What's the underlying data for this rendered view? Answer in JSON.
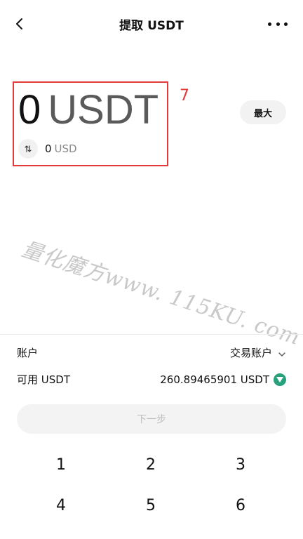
{
  "header": {
    "title": "提取 USDT",
    "back_icon": "back-chevron-icon",
    "more_icon": "more-dots-icon"
  },
  "amount": {
    "value": "0",
    "currency": "USDT",
    "usd_value": "0",
    "usd_currency": "USD",
    "swap_icon": "swap-icon"
  },
  "annotation": {
    "number": "7",
    "color": "#e33a3a"
  },
  "max_button": {
    "label": "最大"
  },
  "watermark": {
    "text": "量化魔方www. 115KU. com"
  },
  "account_row": {
    "label": "账户",
    "value": "交易账户",
    "icon": "chevron-down-icon"
  },
  "available_row": {
    "label": "可用 USDT",
    "value": "260.89465901 USDT",
    "icon": "tether-icon",
    "icon_color": "#26a17b"
  },
  "next_button": {
    "label": "下一步"
  },
  "keypad": {
    "keys": [
      "1",
      "2",
      "3",
      "4",
      "5",
      "6"
    ]
  }
}
